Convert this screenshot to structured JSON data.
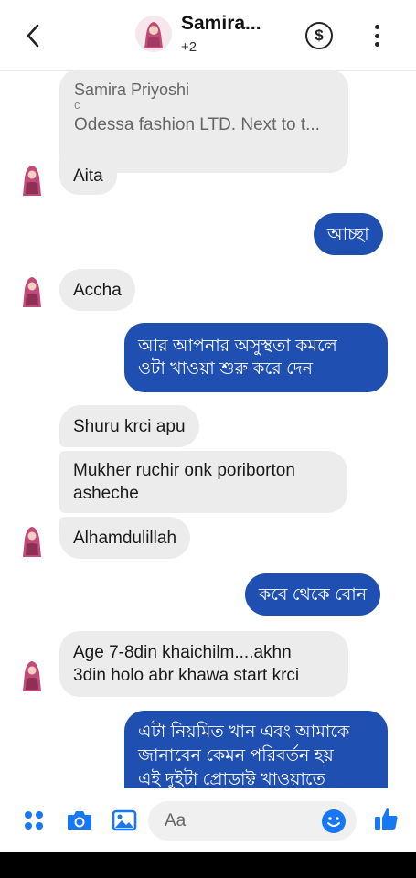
{
  "header": {
    "title": "Samira...",
    "subtitle": "+2",
    "dollar_symbol": "$"
  },
  "reply_preview": {
    "sender": "Samira Priyoshi",
    "text": "Odessa fashion LTD. Next to t..."
  },
  "messages": [
    {
      "dir": "in",
      "text": "Aita"
    },
    {
      "dir": "out",
      "text": "আচ্ছা"
    },
    {
      "dir": "in",
      "text": "Accha"
    },
    {
      "dir": "out",
      "lines": [
        "আর আপনার অসুস্থতা কমলে",
        "ওটা খাওয়া শুরু করে দেন"
      ]
    },
    {
      "dir": "in",
      "text": "Shuru krci apu"
    },
    {
      "dir": "in",
      "lines": [
        "Mukher ruchir onk poriborton",
        "asheche"
      ]
    },
    {
      "dir": "in",
      "text": "Alhamdulillah"
    },
    {
      "dir": "out",
      "text": "কবে থেকে বোন"
    },
    {
      "dir": "in",
      "lines": [
        "Age 7-8din khaichilm....akhn",
        "3din holo abr khawa start krci"
      ]
    },
    {
      "dir": "out",
      "lines": [
        "এটা নিয়মিত খান এবং আমাকে",
        "জানাবেন কেমন পরিবর্তন হয়",
        "এই দুইটা প্রোডাক্ট খাওয়াতে"
      ]
    }
  ],
  "composer": {
    "placeholder": "Aa"
  },
  "colors": {
    "accent": "#1f4fb0",
    "incoming_bubble": "#ececec",
    "icon_blue": "#1877f2"
  },
  "icons": [
    "back-arrow-icon",
    "dollar-icon",
    "more-vertical-icon",
    "apps-grid-icon",
    "camera-icon",
    "gallery-icon",
    "emoji-icon",
    "thumbs-up-icon"
  ]
}
